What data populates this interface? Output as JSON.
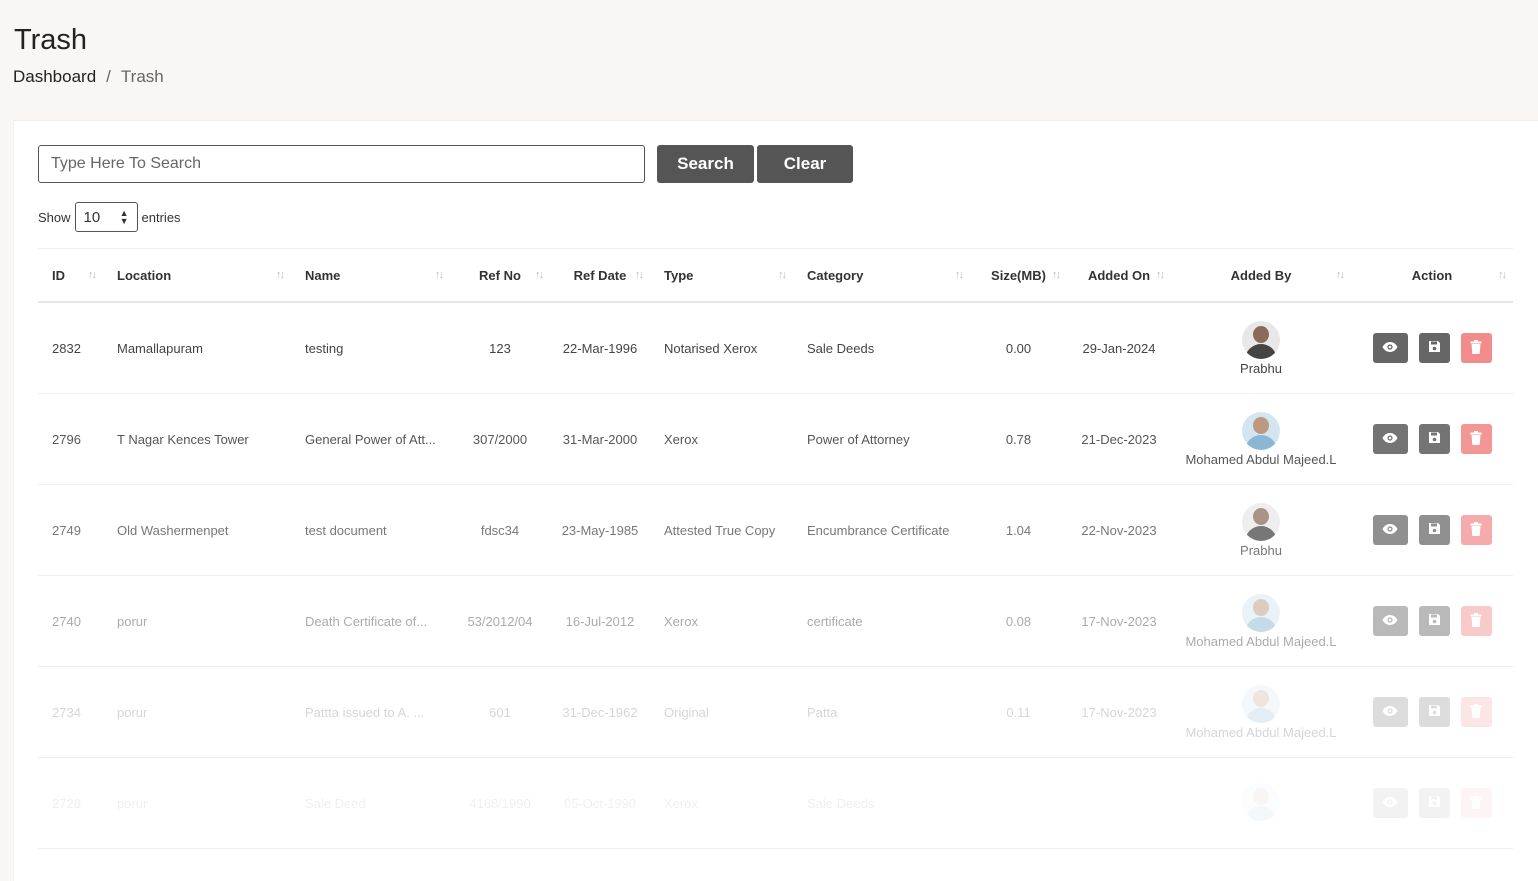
{
  "page": {
    "title": "Trash"
  },
  "breadcrumb": {
    "home": "Dashboard",
    "separator": "/",
    "current": "Trash"
  },
  "search": {
    "placeholder": "Type Here To Search",
    "value": "",
    "search_label": "Search",
    "clear_label": "Clear"
  },
  "length": {
    "show_label": "Show",
    "value": "10",
    "entries_label": "entries"
  },
  "table": {
    "columns": [
      "ID",
      "Location",
      "Name",
      "Ref No",
      "Ref Date",
      "Type",
      "Category",
      "Size(MB)",
      "Added On",
      "Added By",
      "Action"
    ],
    "rows": [
      {
        "id": "2832",
        "location": "Mamallapuram",
        "name": "testing",
        "ref_no": "123",
        "ref_date": "22-Mar-1996",
        "type": "Notarised Xerox",
        "category": "Sale Deeds",
        "size": "0.00",
        "added_on": "29-Jan-2024",
        "added_by": "Prabhu"
      },
      {
        "id": "2796",
        "location": "T Nagar Kences Tower",
        "name": "General Power of Att...",
        "ref_no": "307/2000",
        "ref_date": "31-Mar-2000",
        "type": "Xerox",
        "category": "Power of Attorney",
        "size": "0.78",
        "added_on": "21-Dec-2023",
        "added_by": "Mohamed Abdul Majeed.L"
      },
      {
        "id": "2749",
        "location": "Old Washermenpet",
        "name": "test document",
        "ref_no": "fdsc34",
        "ref_date": "23-May-1985",
        "type": "Attested True Copy",
        "category": "Encumbrance Certificate",
        "size": "1.04",
        "added_on": "22-Nov-2023",
        "added_by": "Prabhu"
      },
      {
        "id": "2740",
        "location": "porur",
        "name": "Death Certificate of...",
        "ref_no": "53/2012/04",
        "ref_date": "16-Jul-2012",
        "type": "Xerox",
        "category": "certificate",
        "size": "0.08",
        "added_on": "17-Nov-2023",
        "added_by": "Mohamed Abdul Majeed.L"
      },
      {
        "id": "2734",
        "location": "porur",
        "name": "Pattta issued to A. ...",
        "ref_no": "601",
        "ref_date": "31-Dec-1962",
        "type": "Original",
        "category": "Patta",
        "size": "0.11",
        "added_on": "17-Nov-2023",
        "added_by": "Mohamed Abdul Majeed.L"
      },
      {
        "id": "2728",
        "location": "porur",
        "name": "Sale Deed",
        "ref_no": "4168/1990",
        "ref_date": "05-Oct-1990",
        "type": "Xerox",
        "category": "Sale Deeds",
        "size": "",
        "added_on": "",
        "added_by": ""
      }
    ]
  },
  "colors": {
    "button_dark": "#555555",
    "delete": "#f28b8b",
    "background": "#f9f7f5"
  },
  "icons": {
    "view": "eye-icon",
    "save": "floppy-disk-icon",
    "delete": "trash-icon",
    "sort": "sort-arrows-icon"
  }
}
